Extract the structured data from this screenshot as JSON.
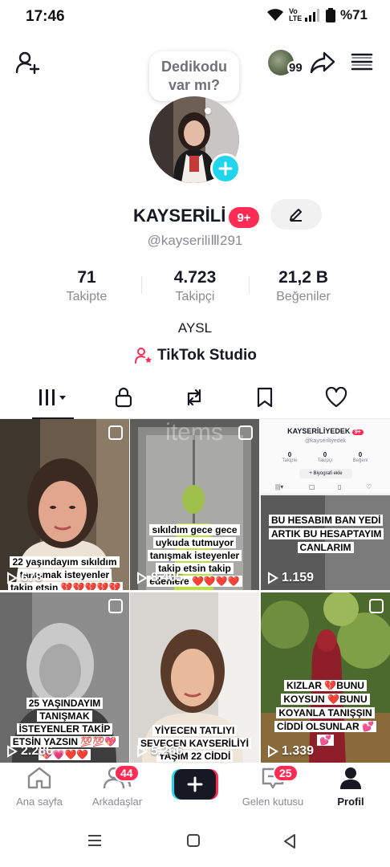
{
  "status_bar": {
    "time": "17:46",
    "network": "Vo LTE",
    "battery": "%71"
  },
  "top_bar": {
    "add_friend_icon": "person-add-icon",
    "profile_views_count": "99",
    "share_icon": "share-icon",
    "menu_icon": "menu-icon"
  },
  "bubble": {
    "text_line1": "Dedikodu",
    "text_line2": "var mı?"
  },
  "profile": {
    "display_name": "KAYSERİLİ",
    "badge": "9+",
    "handle": "@kayseriliⅢ291",
    "bio": "AYSL",
    "studio_label": "TikTok Studio"
  },
  "stats": [
    {
      "value": "71",
      "label": "Takipte"
    },
    {
      "value": "4.723",
      "label": "Takipçi"
    },
    {
      "value": "21,2 B",
      "label": "Beğeniler"
    }
  ],
  "tabs": [
    "videos",
    "private",
    "reposts",
    "saved",
    "liked"
  ],
  "videos": [
    {
      "views": "678",
      "caption": "22 yaşındayım sıkıldım tanışmak isteyenler takip etsin 💔💔💔💔💔💔"
    },
    {
      "views": "8.405",
      "caption": "sıkıldım gece gece uykuda tutmuyor tanışmak isteyenler takip etsin takip edenlere ❤️❤️❤️❤️"
    },
    {
      "views": "1.159",
      "caption": "BU HESABIM BAN YEDİ ARTIK BU HESAPTAYIM CANLARIM",
      "inner": {
        "name": "KAYSERİLİYEDEK",
        "badge": "9+",
        "handle": "@kayseriliyedek",
        "stats": [
          {
            "value": "0",
            "label": "Takipte"
          },
          {
            "value": "0",
            "label": "Takipçi"
          },
          {
            "value": "0",
            "label": "Beğeni"
          }
        ],
        "bio_btn": "+ Biyografi ekle"
      }
    },
    {
      "views": "2.286",
      "caption": "25 YAŞINDAYIM TANIŞMAK İSTEYENLER TAKİP ETSİN YAZSIN 💯💯💖💖💗❤️❤️"
    },
    {
      "views": "5.266",
      "caption": "YİYECEN TATLIYI SEVECEN KAYSERİLİYİ YAŞIM 22 CİDDİ"
    },
    {
      "views": "1.339",
      "caption": "KIZLAR 💔BUNU KOYSUN ❤️BUNU KOYANLA TANIŞŞIN CİDDİ OLSUNLAR 💕💕"
    }
  ],
  "bottom_nav": {
    "home": "Ana sayfa",
    "friends": "Arkadaşlar",
    "friends_count": "44",
    "inbox": "Gelen kutusu",
    "inbox_count": "25",
    "profile": "Profil"
  },
  "colors": {
    "accent_red": "#fe2c55",
    "accent_cyan": "#20d5ec",
    "text_primary": "#161823",
    "text_secondary": "#8a8b91"
  }
}
